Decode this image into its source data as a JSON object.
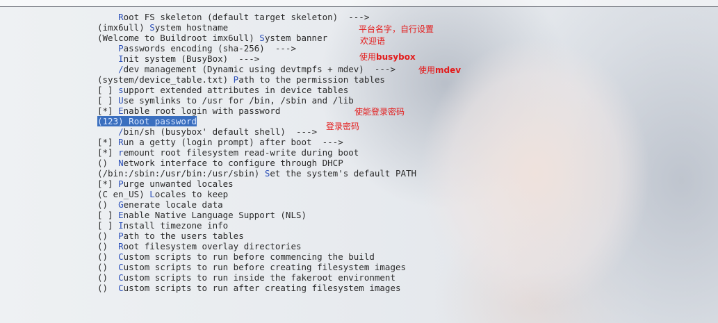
{
  "menu": {
    "items": [
      {
        "prefix": "    ",
        "hotkey": "R",
        "rest": "oot FS skeleton (default target skeleton)  --->"
      },
      {
        "prefix": "(imx6ull) ",
        "hotkey": "S",
        "rest": "ystem hostname"
      },
      {
        "prefix": "(Welcome to Buildroot imx6ull) ",
        "hotkey": "S",
        "rest": "ystem banner"
      },
      {
        "prefix": "    ",
        "hotkey": "P",
        "rest": "asswords encoding (sha-256)  --->"
      },
      {
        "prefix": "    ",
        "hotkey": "I",
        "rest": "nit system (BusyBox)  --->"
      },
      {
        "prefix": "    ",
        "hotkey": "/",
        "rest": "dev management (Dynamic using devtmpfs + mdev)  --->"
      },
      {
        "prefix": "(system/device_table.txt) ",
        "hotkey": "P",
        "rest": "ath to the permission tables"
      },
      {
        "prefix": "[ ] ",
        "hotkey": "s",
        "rest": "upport extended attributes in device tables"
      },
      {
        "prefix": "[ ] ",
        "hotkey": "U",
        "rest": "se symlinks to /usr for /bin, /sbin and /lib"
      },
      {
        "prefix": "[*] ",
        "hotkey": "E",
        "rest": "nable root login with password"
      },
      {
        "prefix": "(123) ",
        "hotkey": "R",
        "rest": "oot password",
        "selected": true
      },
      {
        "prefix": "    ",
        "hotkey": "/",
        "rest": "bin/sh (busybox' default shell)  --->"
      },
      {
        "prefix": "[*] ",
        "hotkey": "R",
        "rest": "un a getty (login prompt) after boot  --->"
      },
      {
        "prefix": "[*] ",
        "hotkey": "r",
        "rest": "emount root filesystem read-write during boot"
      },
      {
        "prefix": "()  ",
        "hotkey": "N",
        "rest": "etwork interface to configure through DHCP"
      },
      {
        "prefix": "(/bin:/sbin:/usr/bin:/usr/sbin) ",
        "hotkey": "S",
        "rest": "et the system's default PATH"
      },
      {
        "prefix": "[*] ",
        "hotkey": "P",
        "rest": "urge unwanted locales"
      },
      {
        "prefix": "(C en_US) ",
        "hotkey": "L",
        "rest": "ocales to keep"
      },
      {
        "prefix": "()  ",
        "hotkey": "G",
        "rest": "enerate locale data"
      },
      {
        "prefix": "[ ] ",
        "hotkey": "E",
        "rest": "nable Native Language Support (NLS)"
      },
      {
        "prefix": "[ ] ",
        "hotkey": "I",
        "rest": "nstall timezone info"
      },
      {
        "prefix": "()  ",
        "hotkey": "P",
        "rest": "ath to the users tables"
      },
      {
        "prefix": "()  ",
        "hotkey": "R",
        "rest": "oot filesystem overlay directories"
      },
      {
        "prefix": "()  ",
        "hotkey": "C",
        "rest": "ustom scripts to run before commencing the build"
      },
      {
        "prefix": "()  ",
        "hotkey": "C",
        "rest": "ustom scripts to run before creating filesystem images"
      },
      {
        "prefix": "()  ",
        "hotkey": "C",
        "rest": "ustom scripts to run inside the fakeroot environment"
      },
      {
        "prefix": "()  ",
        "hotkey": "C",
        "rest": "ustom scripts to run after creating filesystem images"
      }
    ]
  },
  "annotations": {
    "hostname_note": "平台名字，自行设置",
    "banner_note": "欢迎语",
    "busybox_note_prefix": "使用",
    "busybox_note_bold": "busybox",
    "mdev_note_prefix": "使用",
    "mdev_note_bold": "mdev",
    "root_login_note": "使能登录密码",
    "password_note": "登录密码"
  },
  "colors": {
    "hotkey": "#2b4fb8",
    "selection": "#3a6fbf",
    "annotation": "#e31b1b"
  }
}
